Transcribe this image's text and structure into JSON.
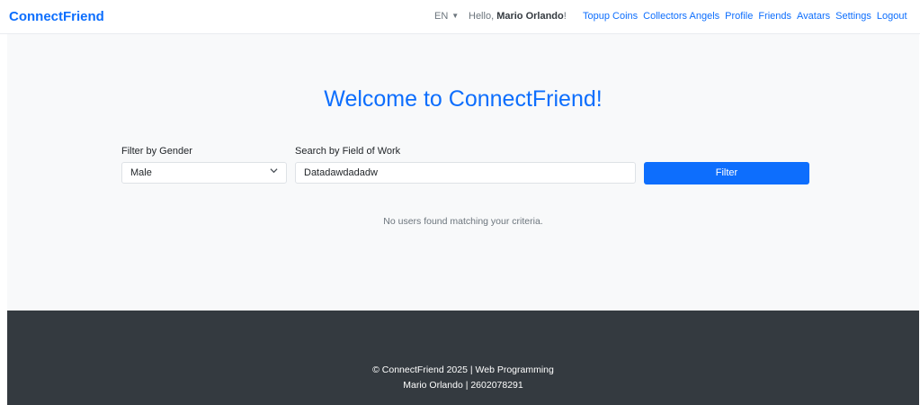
{
  "navbar": {
    "brand": "ConnectFriend",
    "language": "EN",
    "greeting_prefix": "Hello,",
    "user_name": "Mario Orlando",
    "greeting_suffix": "!",
    "links": [
      "Topup Coins",
      "Collectors Angels",
      "Profile",
      "Friends",
      "Avatars",
      "Settings",
      "Logout"
    ]
  },
  "main": {
    "title": "Welcome to ConnectFriend!",
    "gender_label": "Filter by Gender",
    "gender_value": "Male",
    "work_label": "Search by Field of Work",
    "work_value": "Datadawdadadw",
    "filter_button": "Filter",
    "empty_message": "No users found matching your criteria."
  },
  "footer": {
    "line1": "© ConnectFriend 2025 | Web Programming",
    "line2": "Mario Orlando | 2602078291"
  },
  "colors": {
    "primary": "#0d6efd",
    "footer_bg": "#343a40",
    "main_bg": "#f8f9fa"
  }
}
